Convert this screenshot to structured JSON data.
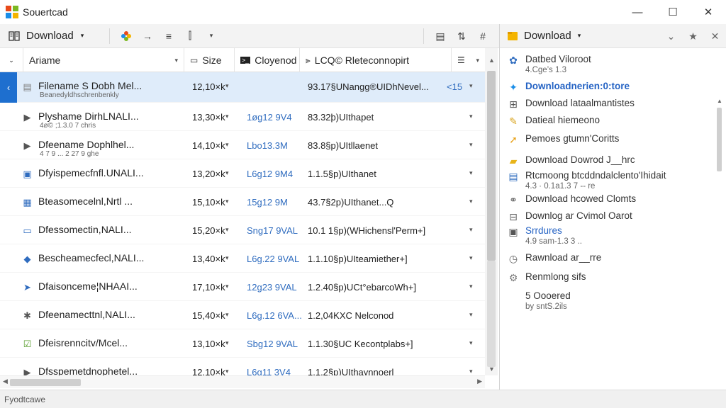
{
  "window": {
    "title": "Souertcad",
    "controls": {
      "minimize": "—",
      "maximize": "☐",
      "close": "✕"
    },
    "app_icon_colors": [
      "#e84a1a",
      "#7bb821",
      "#1b8ee8",
      "#f4b400"
    ]
  },
  "toolbar": {
    "download_label": "Download",
    "caret": "▾",
    "icons": [
      "colorful-pinwheel-icon",
      "arrow-right-icon",
      "list-icon",
      "bar-chart-icon",
      "dropdown-icon"
    ],
    "right_icons": [
      "monitor-icon",
      "sort-icon",
      "grid-icon"
    ]
  },
  "sidebar_header": {
    "label": "Download",
    "caret": "▾",
    "actions": [
      "chevron-down-icon",
      "star-icon",
      "close-icon"
    ]
  },
  "columns": {
    "name": "Ariame",
    "size": "Size",
    "download": "Cloyenod",
    "info": "LCQ© Rleteconnopirt"
  },
  "rows": [
    {
      "name": "Filename S Dobh Mel...",
      "sub": "Beanedyldhschrenbenkly",
      "size": "12,10×k",
      "date": "",
      "info": "93.17§UNangg®UIDhNevel...",
      "ext": "<15",
      "icon": "document-icon",
      "icon_color": "#7f7f7f"
    },
    {
      "name": "Plyshame DirhLNALI...",
      "sub": "4ø© ;1.3.0 7 chris",
      "size": "13,30×k",
      "date": "1øg12 9V4",
      "info": "83.32þ)UIthapet",
      "ext": "",
      "icon": "play-icon",
      "icon_color": "#555555"
    },
    {
      "name": "Dfeename Dophlhel...",
      "sub": "4 7 9 ... 2 27 9 ghe",
      "size": "14,10×k",
      "date": "Lbo13.3M",
      "info": "83.8§p)UItllaenet",
      "ext": "",
      "icon": "play-icon",
      "icon_color": "#555555"
    },
    {
      "name": "Dfyispemecfnfl.UNALI...",
      "sub": "",
      "size": "13,20×k",
      "date": "L6g12 9M4",
      "info": "1.1.5§p)UIthanet",
      "ext": "",
      "icon": "monitor-icon",
      "icon_color": "#2f6cbf"
    },
    {
      "name": "Bteasomecelnl,Nrtl ...",
      "sub": "",
      "size": "15,10×k",
      "date": "15g12 9M",
      "info": "43.7§2p)UIthanet...Q",
      "ext": "",
      "icon": "calendar-icon",
      "icon_color": "#2f6cbf"
    },
    {
      "name": "Dfessomectin,NALI...",
      "sub": "",
      "size": "15,20×k",
      "date": "Sng17 9VAL",
      "info": "10.1 1§p)(WHichensl'Perm+]",
      "ext": "",
      "icon": "credit-card-icon",
      "icon_color": "#2f6cbf"
    },
    {
      "name": "Bescheamecfecl,NALI...",
      "sub": "",
      "size": "13,40×k",
      "date": "L6g.22 9VAL",
      "info": "1.1.10§p)UIteamiether+]",
      "ext": "",
      "icon": "droplet-icon",
      "icon_color": "#2f6cbf"
    },
    {
      "name": "Dfaisonceme¦NHAAI...",
      "sub": "",
      "size": "17,10×k",
      "date": "12g23 9VAL",
      "info": "1.2.40§p)UCt°ebarcoWh+]",
      "ext": "",
      "icon": "send-icon",
      "icon_color": "#2f6cbf"
    },
    {
      "name": "Dfeenamecttnl,NALI...",
      "sub": "",
      "size": "15,40×k",
      "date": "L6g.12 6VA...",
      "info": "1.2,04KXC Nelconod",
      "ext": "",
      "icon": "asterisk-icon",
      "icon_color": "#555555"
    },
    {
      "name": "Dfeisrenncitv/Mcel...",
      "sub": "",
      "size": "13,10×k",
      "date": "Sbg12 9VAL",
      "info": "1.1.30§UC Kecontplabs+]",
      "ext": "",
      "icon": "checkbox-icon",
      "icon_color": "#5a9e2f"
    },
    {
      "name": "Dfsspemetdnophetel...",
      "sub": "",
      "size": "12,10×k",
      "date": "L6g11 3V4",
      "info": "1.1.2§p)UIthaynnoerl",
      "ext": "",
      "icon": "play-icon",
      "icon_color": "#555555"
    }
  ],
  "sidebar": [
    {
      "text": "Datbed Viloroot",
      "sub": "4.Cge’s 1.3",
      "icon": "people-icon",
      "color": "#2f6cbf",
      "style": ""
    },
    {
      "text": "Downloadnerien:0:tore",
      "sub": "",
      "icon": "sparkle-icon",
      "color": "#1b8ee8",
      "style": "blue bold"
    },
    {
      "text": "Download lataalmantistes",
      "sub": "",
      "icon": "download-grid-icon",
      "color": "#555555",
      "style": ""
    },
    {
      "text": "Datieal hiemeono",
      "sub": "",
      "icon": "wrench-icon",
      "color": "#d9a521",
      "style": ""
    },
    {
      "text": "Pemoes gtumn'Coritts",
      "sub": "",
      "icon": "arrow-up-right-icon",
      "color": "#e8a21a",
      "style": ""
    },
    {
      "text": "Download Dowrod J__hrc",
      "sub": "",
      "icon": "folder-icon",
      "color": "#e8b419",
      "style": ""
    },
    {
      "text": "Rtcmoong btcddndalclento'Ihidait",
      "sub": "4.3 · 0.1a1.3 7 -- re",
      "icon": "document-blue-icon",
      "color": "#2f6cbf",
      "style": ""
    },
    {
      "text": "Download hcowed Clomts",
      "sub": "",
      "icon": "link-icon",
      "color": "#666666",
      "style": ""
    },
    {
      "text": "Downlog ar Cvimol Oarot",
      "sub": "",
      "icon": "layout-icon",
      "color": "#666666",
      "style": ""
    },
    {
      "text": "Srrdures",
      "sub": "4.9 sam-1.3 3 ..",
      "icon": "window-icon",
      "color": "#555555",
      "style": "blue"
    },
    {
      "text": "Rawnload ar__rre",
      "sub": "",
      "icon": "clock-icon",
      "color": "#666666",
      "style": ""
    },
    {
      "text": "Renmlong sifs",
      "sub": "",
      "icon": "gear-icon",
      "color": "#777777",
      "style": ""
    },
    {
      "text": "5 Oooered",
      "sub": "by sntS.2ils",
      "icon": "",
      "color": "#666666",
      "style": ""
    }
  ],
  "status": {
    "text": "Fyodtcawe"
  }
}
